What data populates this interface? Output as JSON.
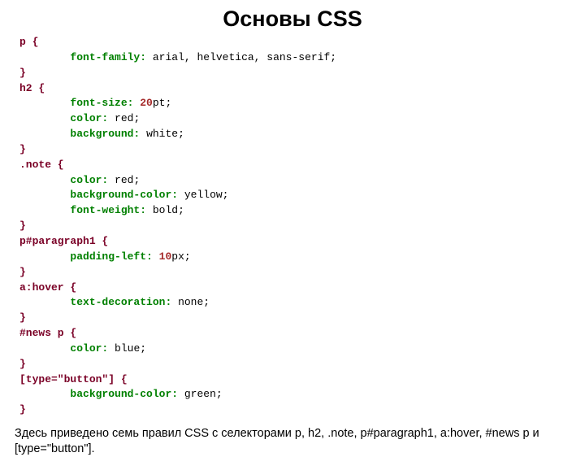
{
  "title": "Основы CSS",
  "rules": [
    {
      "sel_open": "p {",
      "decls": [
        {
          "prop": "font-family",
          "val": "arial, helvetica, sans-serif"
        }
      ],
      "sel_close": "}"
    },
    {
      "sel_open": "h2 {",
      "decls": [
        {
          "prop": "font-size",
          "num": "20",
          "unit": "pt"
        },
        {
          "prop": "color",
          "val": "red"
        },
        {
          "prop": "background",
          "val": "white"
        }
      ],
      "sel_close": "}"
    },
    {
      "sel_open": ".note {",
      "decls": [
        {
          "prop": "color",
          "val": "red"
        },
        {
          "prop": "background-color",
          "val": "yellow"
        },
        {
          "prop": "font-weight",
          "val": "bold"
        }
      ],
      "sel_close": "}"
    },
    {
      "sel_open": "p#paragraph1 {",
      "decls": [
        {
          "prop": "padding-left",
          "num": "10",
          "unit": "px"
        }
      ],
      "sel_close": "}"
    },
    {
      "sel_open": "a:hover {",
      "decls": [
        {
          "prop": "text-decoration",
          "val": "none"
        }
      ],
      "sel_close": "}"
    },
    {
      "sel_open": "#news p {",
      "decls": [
        {
          "prop": "color",
          "val": "blue"
        }
      ],
      "sel_close": "}"
    },
    {
      "sel_open": "[type=\"button\"] {",
      "decls": [
        {
          "prop": "background-color",
          "val": "green"
        }
      ],
      "sel_close": "}"
    }
  ],
  "footer": "Здесь приведено семь правил CSS с  селекторами p, h2, .note, p#paragraph1, a:hover, #news p и [type=\"button\"]."
}
